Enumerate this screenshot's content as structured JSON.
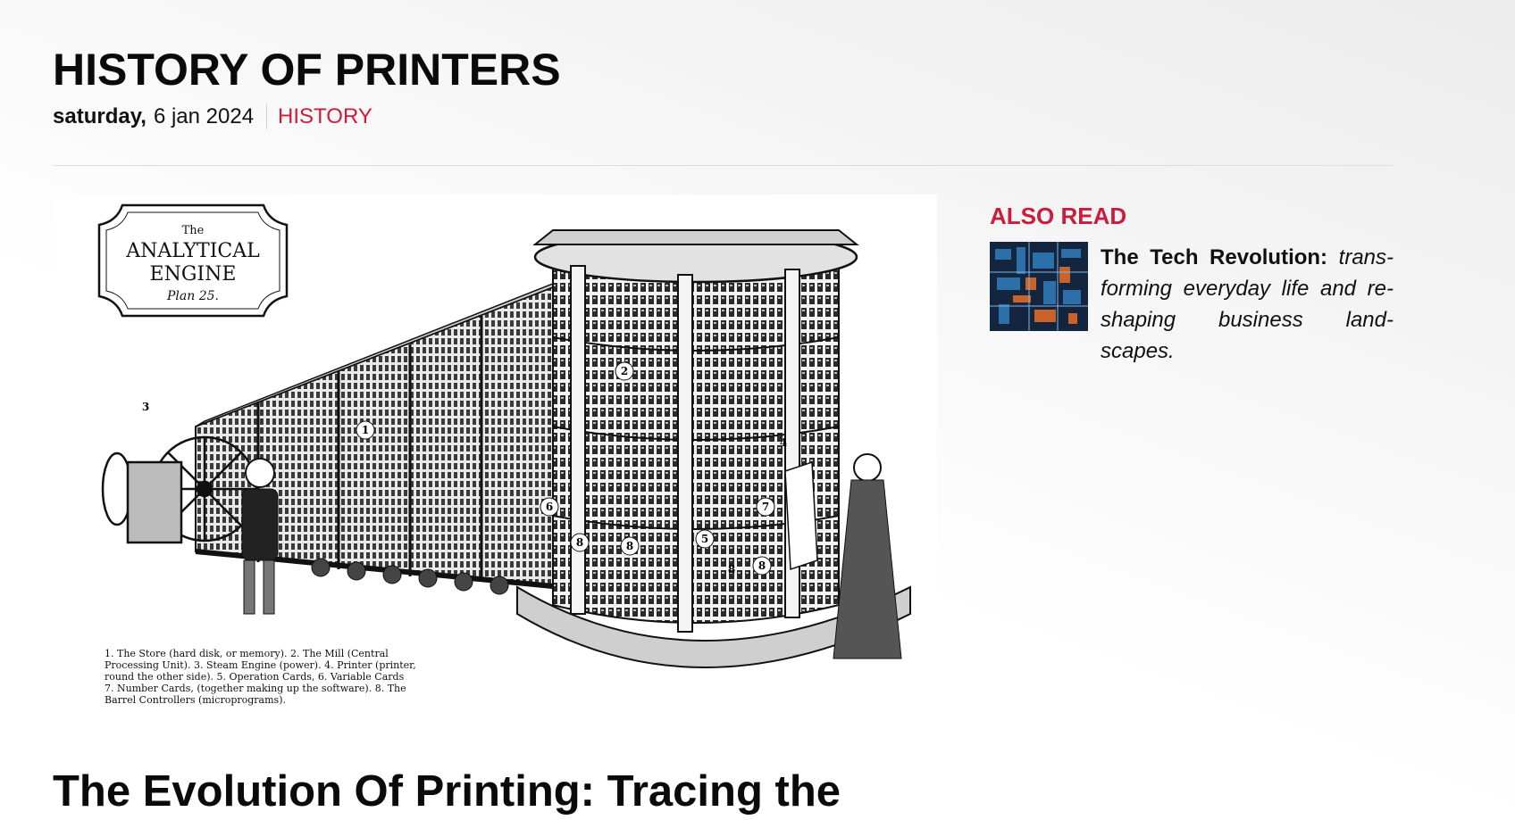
{
  "page": {
    "title": "HISTORY OF PRINTERS",
    "day": "saturday,",
    "date": "6 jan 2024",
    "category": "HISTORY"
  },
  "hero_image": {
    "icon": "analytical-engine-illustration",
    "plate": {
      "small": "The",
      "line1": "ANALYTICAL",
      "line2": "ENGINE",
      "script": "Plan 25."
    },
    "numbers": [
      "1",
      "2",
      "3",
      "4",
      "5",
      "6",
      "7",
      "8",
      "8",
      "8",
      "8"
    ],
    "caption_lines": [
      "1. The Store (hard disk, or memory). 2. The Mill (Central",
      "Processing Unit). 3. Steam Engine (power). 4. Printer (printer,",
      "round the other side). 5. Operation Cards, 6. Variable Cards",
      "7. Number Cards, (together making up the software). 8. The",
      "Barrel Controllers (microprograms)."
    ]
  },
  "article": {
    "title": "The Evolution Of Printing: Tracing the"
  },
  "also_read": {
    "label": "ALSO READ",
    "item": {
      "thumb_icon": "circuit-board-thumbnail",
      "title": "The Tech Revolution:",
      "summary": "trans-forming everyday life and re-shaping business land-scapes."
    }
  },
  "colors": {
    "accent": "#cc1c3c",
    "text": "#111111",
    "rule": "#dcdcdc"
  }
}
